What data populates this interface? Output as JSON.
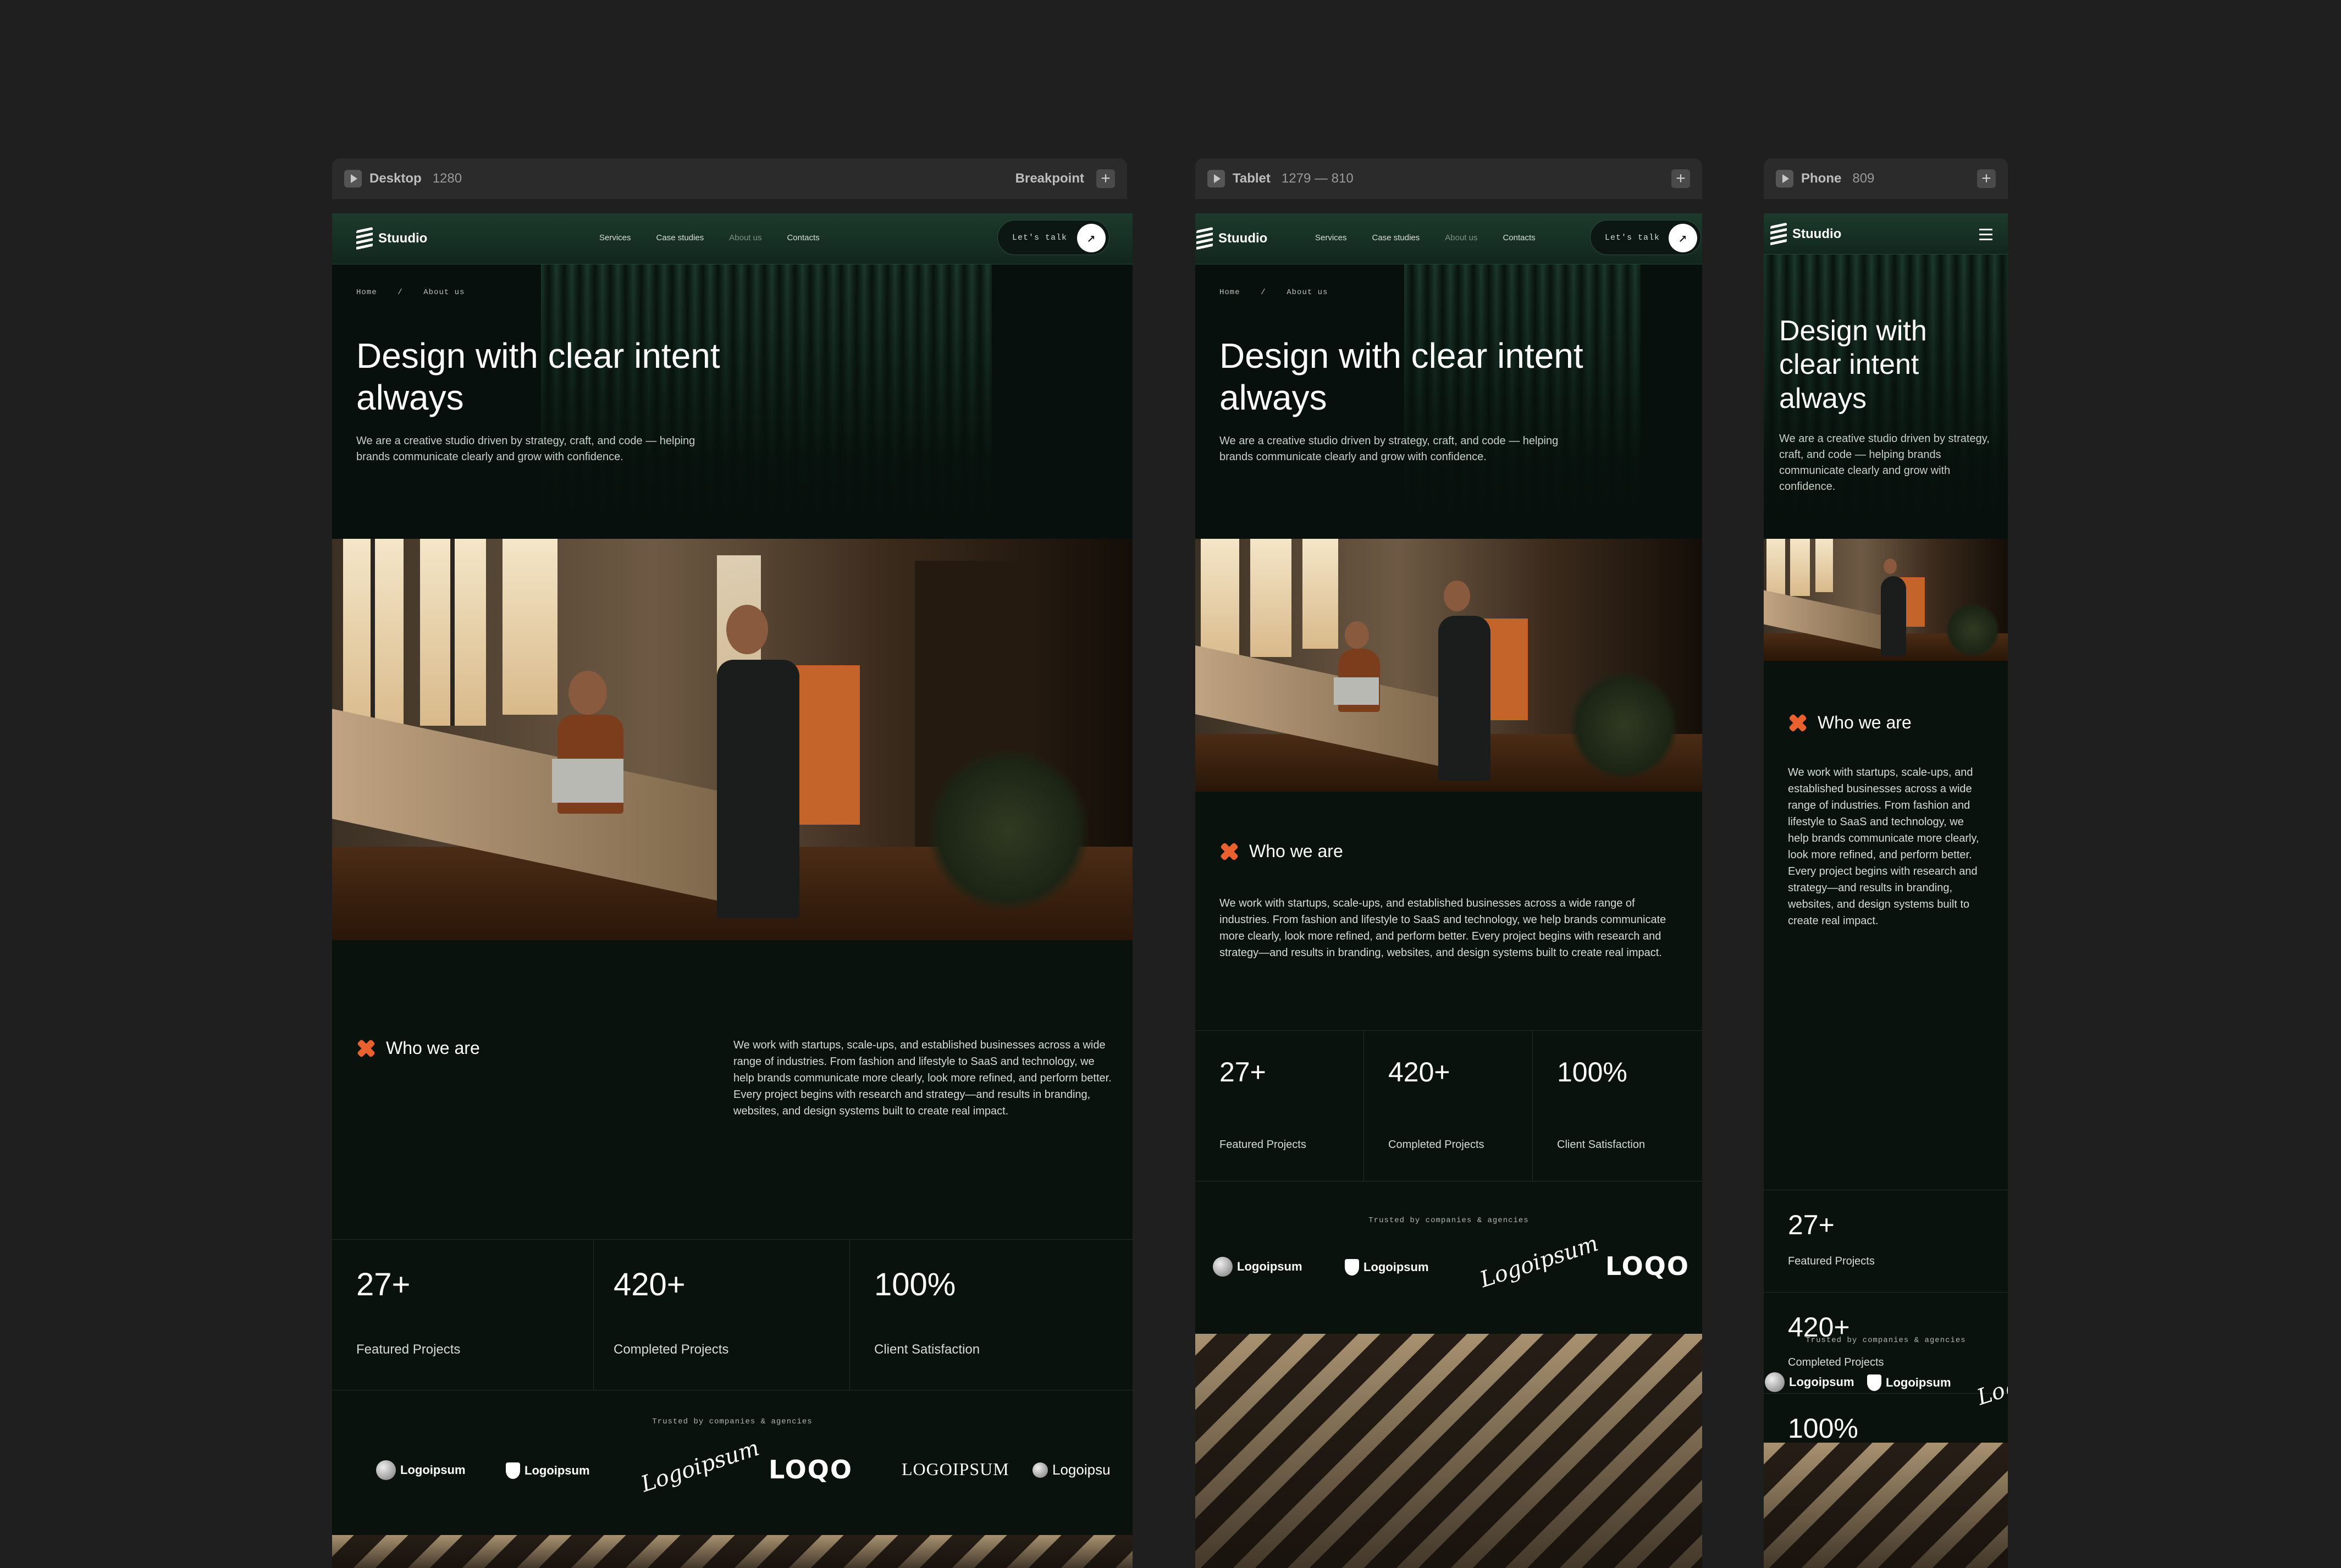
{
  "frames": {
    "desktop": {
      "name": "Desktop",
      "width_label": "1280",
      "right_label": "Breakpoint"
    },
    "tablet": {
      "name": "Tablet",
      "width_label": "1279 — 810"
    },
    "phone": {
      "name": "Phone",
      "width_label": "809"
    }
  },
  "nav": {
    "brand": "Stuudio",
    "links": [
      "Services",
      "Case studies",
      "About us",
      "Contacts"
    ],
    "cta": "Let's talk",
    "cta_icon": "arrow-up-right-icon"
  },
  "breadcrumb": {
    "home": "Home",
    "sep": "/",
    "current": "About us"
  },
  "hero": {
    "title": "Design with clear intent always",
    "subtitle": "We are a creative studio driven by strategy, craft, and code — helping brands communicate clearly and grow with confidence."
  },
  "who": {
    "title": "Who we are",
    "text": "We work with startups, scale-ups, and established businesses across a wide range of industries. From fashion and lifestyle to SaaS and technology, we help brands communicate more clearly, look more refined, and perform better. Every project begins with research and strategy—and results in branding, websites, and design systems built to create real impact."
  },
  "stats": [
    {
      "value": "27+",
      "label": "Featured Projects"
    },
    {
      "value": "420+",
      "label": "Completed Projects"
    },
    {
      "value": "100%",
      "label": "Client Satisfaction"
    }
  ],
  "trusted": "Trusted by companies & agencies",
  "logos": [
    "Logoipsum",
    "Logoipsum",
    "Logoipsum",
    "LOQO",
    "LOGOIPSUM",
    "Logoipsu"
  ],
  "colors": {
    "accent": "#e8612e",
    "background": "#0a120e",
    "canvas": "#1f1f20"
  }
}
